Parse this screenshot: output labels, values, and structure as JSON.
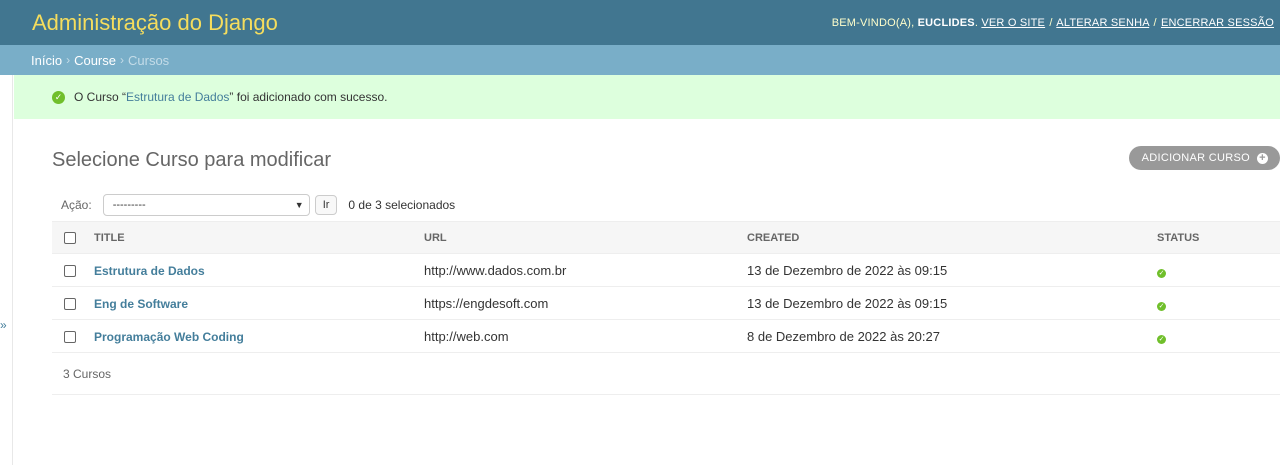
{
  "header": {
    "site_name": "Administração do Django",
    "welcome": "Bem-vindo(a),",
    "username": "Euclides",
    "view_site": "Ver o site",
    "change_password": "Alterar senha",
    "logout": "Encerrar sessão"
  },
  "breadcrumbs": {
    "home": "Início",
    "app": "Course",
    "current": "Cursos",
    "separator": "›"
  },
  "sidebar": {
    "toggle": "»"
  },
  "message": {
    "prefix": "O Curso “",
    "object_name": "Estrutura de Dados",
    "suffix": "” foi adicionado com sucesso."
  },
  "content": {
    "title": "Selecione Curso para modificar",
    "add_button": "Adicionar Curso",
    "action_label": "Ação:",
    "action_selected": "---------",
    "go_button": "Ir",
    "selected_counter": "0 de 3 selecionados",
    "paginator": "3 Cursos"
  },
  "table": {
    "headers": {
      "title": "Title",
      "url": "URL",
      "created": "Created",
      "status": "Status"
    },
    "rows": [
      {
        "title": "Estrutura de Dados",
        "url": "http://www.dados.com.br",
        "created": "13 de Dezembro de 2022 às 09:15",
        "status": true
      },
      {
        "title": "Eng de Software",
        "url": "https://engdesoft.com",
        "created": "13 de Dezembro de 2022 às 09:15",
        "status": true
      },
      {
        "title": "Programação Web Coding",
        "url": "http://web.com",
        "created": "8 de Dezembro de 2022 às 20:27",
        "status": true
      }
    ]
  },
  "colors": {
    "header_bg": "#417690",
    "site_name": "#f5dd5d",
    "breadcrumbs_bg": "#79aec8",
    "success_bg": "#dfd",
    "link": "#447e9b",
    "status_ok": "#70bf2b"
  }
}
